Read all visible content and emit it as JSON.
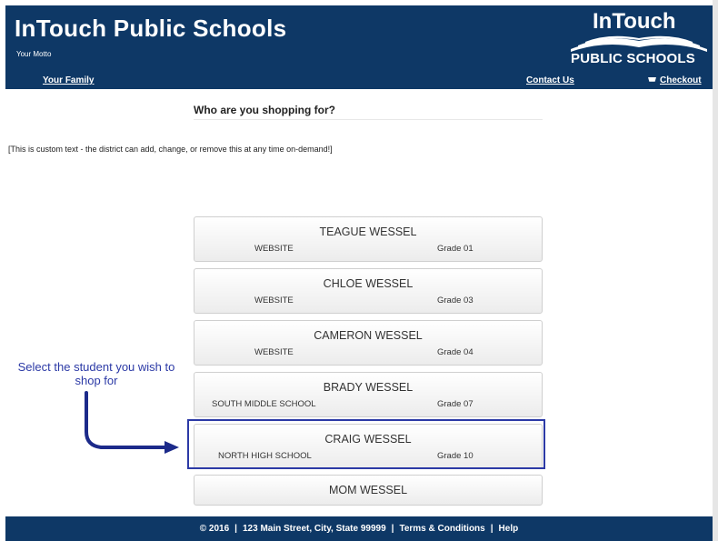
{
  "header": {
    "title": "InTouch Public Schools",
    "motto": "Your Motto",
    "nav": {
      "family": "Your Family",
      "contact": "Contact Us",
      "checkout": "Checkout"
    },
    "logo": {
      "title": "InTouch",
      "subtitle": "PUBLIC SCHOOLS"
    },
    "bg_color": "#0e3866"
  },
  "main": {
    "heading": "Who are you shopping for?",
    "custom_text": "[This is custom text - the district can add, change, or remove this at any time on-demand!]",
    "students": [
      {
        "name": "TEAGUE WESSEL",
        "school": "WEBSITE",
        "grade": "Grade 01"
      },
      {
        "name": "CHLOE WESSEL",
        "school": "WEBSITE",
        "grade": "Grade 03"
      },
      {
        "name": "CAMERON WESSEL",
        "school": "WEBSITE",
        "grade": "Grade 04"
      },
      {
        "name": "BRADY WESSEL",
        "school": "SOUTH MIDDLE SCHOOL",
        "grade": "Grade 07"
      },
      {
        "name": "CRAIG WESSEL",
        "school": "NORTH HIGH SCHOOL",
        "grade": "Grade 10"
      },
      {
        "name": "MOM WESSEL"
      }
    ]
  },
  "callout": {
    "text": "Select the student you wish to shop for",
    "color": "#2c3aa6"
  },
  "footer": {
    "copyright": "© 2016",
    "address": "123 Main Street, City, State 99999",
    "terms": "Terms & Conditions",
    "help": "Help"
  }
}
